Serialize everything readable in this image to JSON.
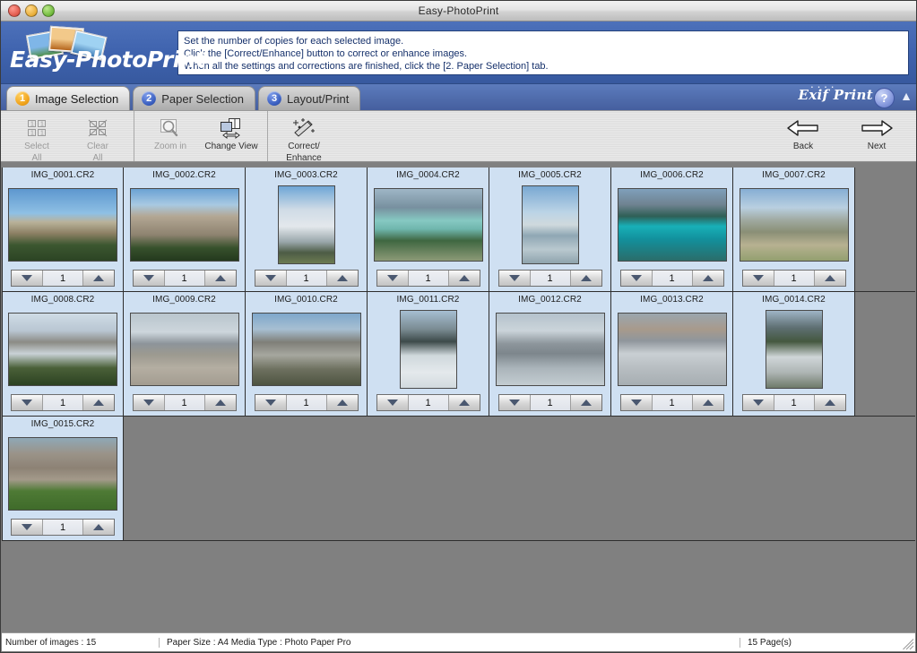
{
  "window": {
    "title": "Easy-PhotoPrint",
    "controls": [
      "close-button",
      "minimize-button",
      "zoom-button"
    ]
  },
  "header": {
    "logo_text": "Easy-PhotoPrint",
    "instructions": [
      "Set the number of copies for each selected image.",
      "Click the [Correct/Enhance] button to correct or enhance images.",
      "When all the settings and corrections are finished, click the [2. Paper Selection] tab."
    ]
  },
  "tabs": [
    {
      "num": "1",
      "label": "Image Selection",
      "active": true
    },
    {
      "num": "2",
      "label": "Paper Selection",
      "active": false
    },
    {
      "num": "3",
      "label": "Layout/Print",
      "active": false
    }
  ],
  "branding": {
    "exif_print": "Exif Print",
    "help_label": "?",
    "collapse_icon": "chevron-up-icon"
  },
  "toolbar": {
    "groups": [
      {
        "buttons": [
          {
            "label_line1": "Select",
            "label_line2": "All",
            "icon": "select-all-icon",
            "disabled": true
          },
          {
            "label_line1": "Clear",
            "label_line2": "All",
            "icon": "clear-all-icon",
            "disabled": true
          }
        ]
      },
      {
        "buttons": [
          {
            "label_line1": "Zoom in",
            "label_line2": "",
            "icon": "magnifier-icon",
            "disabled": true
          },
          {
            "label_line1": "Change View",
            "label_line2": "",
            "icon": "change-view-icon",
            "disabled": false
          }
        ]
      },
      {
        "buttons": [
          {
            "label_line1": "Correct/",
            "label_line2": "Enhance",
            "icon": "magic-wand-icon",
            "disabled": false
          }
        ]
      }
    ],
    "nav": [
      {
        "label": "Back",
        "icon": "arrow-left-icon"
      },
      {
        "label": "Next",
        "icon": "arrow-right-icon"
      }
    ]
  },
  "gallery": {
    "spinner": {
      "down_icon": "triangle-down-icon",
      "up_icon": "triangle-up-icon"
    },
    "rows": [
      [
        {
          "filename": "IMG_0001.CR2",
          "copies": "1",
          "orientation": "landscape",
          "scene": "mountain-ridge-blue-sky"
        },
        {
          "filename": "IMG_0002.CR2",
          "copies": "1",
          "orientation": "landscape",
          "scene": "rocky-peak-forest"
        },
        {
          "filename": "IMG_0003.CR2",
          "copies": "1",
          "orientation": "portrait",
          "scene": "cloudy-sky-road"
        },
        {
          "filename": "IMG_0004.CR2",
          "copies": "1",
          "orientation": "landscape",
          "scene": "turquoise-lake-valley"
        },
        {
          "filename": "IMG_0005.CR2",
          "copies": "1",
          "orientation": "portrait",
          "scene": "lake-louise-reflection"
        },
        {
          "filename": "IMG_0006.CR2",
          "copies": "1",
          "orientation": "landscape",
          "scene": "moraine-lake-teal"
        },
        {
          "filename": "IMG_0007.CR2",
          "copies": "1",
          "orientation": "landscape",
          "scene": "glacier-river-flats"
        }
      ],
      [
        {
          "filename": "IMG_0008.CR2",
          "copies": "1",
          "orientation": "landscape",
          "scene": "snow-mountain-forest"
        },
        {
          "filename": "IMG_0009.CR2",
          "copies": "1",
          "orientation": "landscape",
          "scene": "picnic-area-glacier"
        },
        {
          "filename": "IMG_0010.CR2",
          "copies": "1",
          "orientation": "landscape",
          "scene": "mountain-slope-snow"
        },
        {
          "filename": "IMG_0011.CR2",
          "copies": "1",
          "orientation": "portrait",
          "scene": "glacier-ice-field"
        },
        {
          "filename": "IMG_0012.CR2",
          "copies": "1",
          "orientation": "landscape",
          "scene": "snowcoaches-tourists"
        },
        {
          "filename": "IMG_0013.CR2",
          "copies": "1",
          "orientation": "landscape",
          "scene": "two-snowcoaches"
        },
        {
          "filename": "IMG_0014.CR2",
          "copies": "1",
          "orientation": "portrait",
          "scene": "waterfall-canyon"
        }
      ],
      [
        {
          "filename": "IMG_0015.CR2",
          "copies": "1",
          "orientation": "landscape",
          "scene": "stone-lodge-lawn"
        }
      ]
    ]
  },
  "status": {
    "images": "Number of images : 15",
    "paper": "Paper Size : A4 Media Type : Photo Paper Pro",
    "pages": "15 Page(s)"
  },
  "colors": {
    "header_blue": "#3f63ae",
    "cell_selected": "#cfe0f2",
    "canvas_gray": "#808080",
    "tab_active": "#e6e6e6"
  }
}
